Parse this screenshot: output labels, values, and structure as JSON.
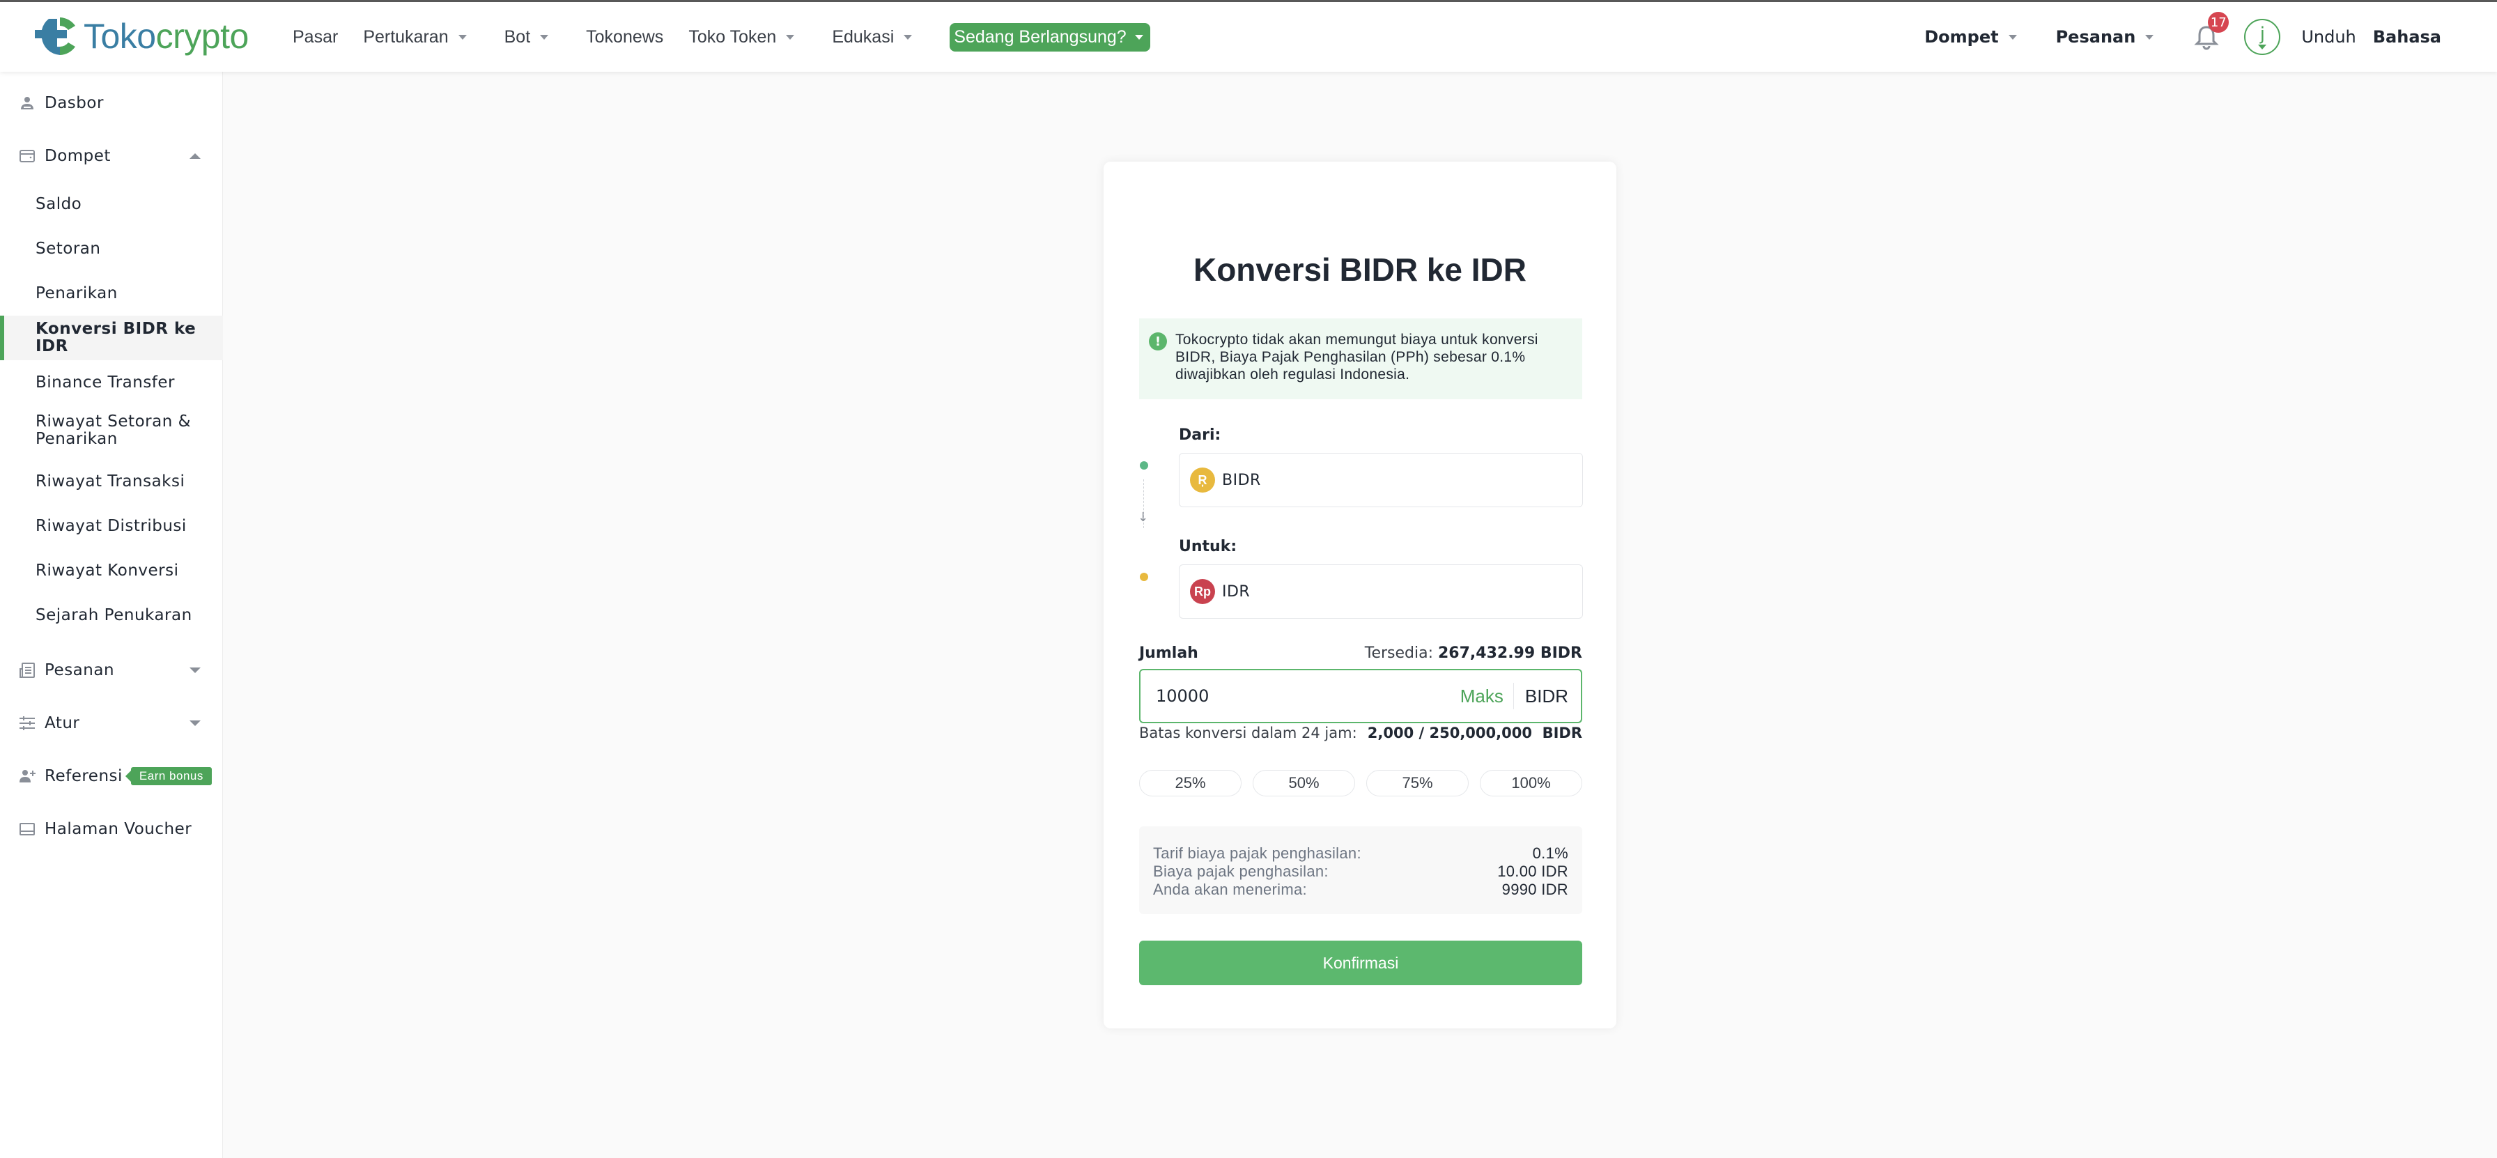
{
  "header": {
    "logo": {
      "part1": "Toko",
      "part2": "crypto"
    },
    "nav": [
      {
        "label": "Pasar",
        "has_dropdown": false
      },
      {
        "label": "Pertukaran",
        "has_dropdown": true
      },
      {
        "label": "Bot",
        "has_dropdown": true
      },
      {
        "label": "Tokonews",
        "has_dropdown": false
      },
      {
        "label": "Toko Token",
        "has_dropdown": true
      },
      {
        "label": "Edukasi",
        "has_dropdown": true
      }
    ],
    "live_button": "Sedang Berlangsung?",
    "right": {
      "wallet": "Dompet",
      "orders": "Pesanan",
      "notification_count": "17",
      "avatar_letter": "j",
      "download": "Unduh",
      "language": "Bahasa"
    }
  },
  "sidebar": {
    "dashboard": "Dasbor",
    "wallet": "Dompet",
    "wallet_items": [
      "Saldo",
      "Setoran",
      "Penarikan",
      "Konversi BIDR ke IDR",
      "Binance Transfer",
      "Riwayat Setoran & Penarikan",
      "Riwayat Transaksi",
      "Riwayat Distribusi",
      "Riwayat Konversi",
      "Sejarah Penukaran"
    ],
    "active_item": "Konversi BIDR ke IDR",
    "orders": "Pesanan",
    "settings": "Atur",
    "referral": "Referensi",
    "referral_badge": "Earn bonus",
    "voucher": "Halaman Voucher"
  },
  "card": {
    "title": "Konversi BIDR ke IDR",
    "notice": "Tokocrypto tidak akan memungut biaya untuk konversi BIDR, Biaya Pajak Penghasilan (PPh) sebesar 0.1% diwajibkan oleh regulasi Indonesia.",
    "from_label": "Dari:",
    "from_coin": "BIDR",
    "from_coin_icon": "Ŗ",
    "to_label": "Untuk:",
    "to_coin": "IDR",
    "to_coin_icon": "Rp",
    "amount_label": "Jumlah",
    "available_label": "Tersedia:",
    "available_value": "267,432.99 BIDR",
    "amount_value": "10000",
    "max_label": "Maks",
    "amount_unit": "BIDR",
    "limit_label": "Batas konversi dalam 24 jam:",
    "limit_value": "2,000 / 250,000,000",
    "limit_unit": "BIDR",
    "percent_buttons": [
      "25%",
      "50%",
      "75%",
      "100%"
    ],
    "summary": [
      {
        "label": "Tarif biaya pajak penghasilan:",
        "value": "0.1%"
      },
      {
        "label": "Biaya pajak penghasilan:",
        "value": "10.00 IDR"
      },
      {
        "label": "Anda akan menerima:",
        "value": "9990 IDR"
      }
    ],
    "confirm_label": "Konfirmasi"
  },
  "colors": {
    "brand_green": "#4da459",
    "brand_blue": "#3a7ea3",
    "badge_red": "#d64550",
    "bidr_coin": "#e8b93e",
    "idr_coin": "#c9424f"
  }
}
